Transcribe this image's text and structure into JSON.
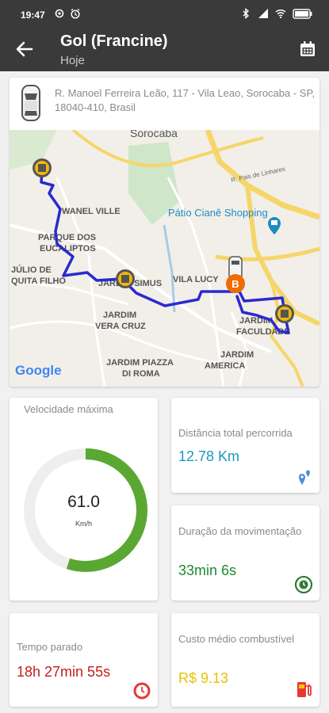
{
  "status_bar": {
    "time": "19:47"
  },
  "header": {
    "title": "Gol (Francine)",
    "subtitle": "Hoje"
  },
  "trip": {
    "address": "R. Manoel Ferreira Leão, 117 - Vila Leao, Sorocaba - SP, 18040-410, Brasil"
  },
  "map": {
    "labels": {
      "sorocaba": "Sorocaba",
      "rua": "R. Pais de Linhares",
      "wanel": "WANEL VILLE",
      "patio": "Pátio Cianê Shopping",
      "parque1": "PARQUE DOS",
      "parque2": "EUCALIPTOS",
      "julio1": "JÚLIO DE",
      "julio2": "QUITA FILHO",
      "jardim_simus": "JARDIM SIMUS",
      "vila_lucy": "VILA LUCY",
      "vera1": "JARDIM",
      "vera2": "VERA CRUZ",
      "faculdade1": "JARDIM",
      "faculdade2": "FACULDADE",
      "piazza1": "JARDIM PIAZZA",
      "piazza2": "DI ROMA",
      "america1": "JARDIM",
      "america2": "AMERICA",
      "google": "Google"
    },
    "end_marker_label": "B"
  },
  "stats": {
    "max_speed": {
      "label": "Velocidade máxima",
      "value": "61.0",
      "unit": "Km/h",
      "gauge_fraction": 0.55
    },
    "distance": {
      "label": "Distância total percorrida",
      "value": "12.78 Km"
    },
    "duration": {
      "label": "Duração da movimentação",
      "value": "33min 6s"
    },
    "idle": {
      "label": "Tempo parado",
      "value": "18h 27min 55s"
    },
    "fuel": {
      "label": "Custo médio combustível",
      "value": "R$ 9.13"
    }
  },
  "colors": {
    "header_bg": "#3a3a3a",
    "route": "#2a2ad0",
    "gauge_fill": "#5aa832",
    "gauge_track": "#eeeeee",
    "distance": "#1a98c4",
    "duration": "#1e8a2e",
    "idle": "#c41e1e",
    "fuel": "#e6c300"
  },
  "icons": {
    "back": "arrow-left-icon",
    "calendar": "calendar-icon",
    "car": "car-top-view-icon",
    "distance": "map-pins-icon",
    "duration": "clock-refresh-icon",
    "idle": "clock-icon",
    "fuel": "fuel-pump-icon"
  }
}
